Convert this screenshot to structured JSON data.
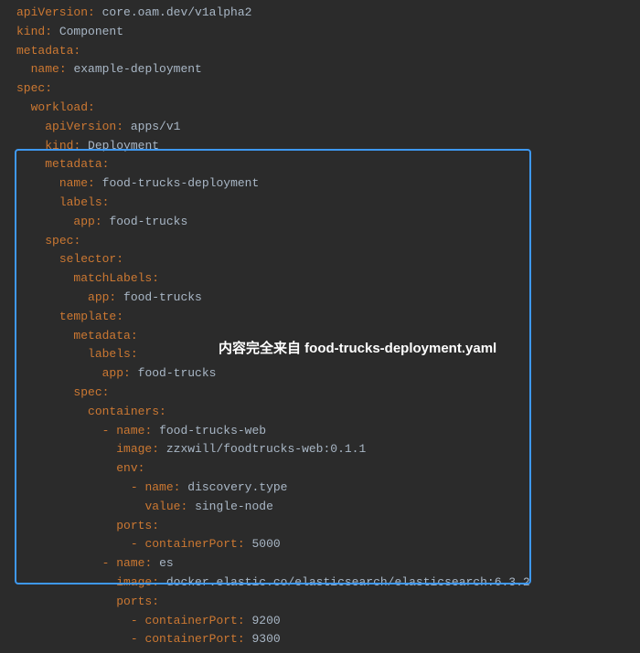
{
  "annotation": "内容完全来自 food-trucks-deployment.yaml",
  "lines": [
    {
      "indent": 0,
      "tokens": [
        {
          "t": "key",
          "v": "apiVersion"
        },
        {
          "t": "col",
          "v": ": "
        },
        {
          "t": "val",
          "v": "core.oam.dev/v1alpha2"
        }
      ]
    },
    {
      "indent": 0,
      "tokens": [
        {
          "t": "key",
          "v": "kind"
        },
        {
          "t": "col",
          "v": ": "
        },
        {
          "t": "val",
          "v": "Component"
        }
      ]
    },
    {
      "indent": 0,
      "tokens": [
        {
          "t": "key",
          "v": "metadata"
        },
        {
          "t": "col",
          "v": ":"
        }
      ]
    },
    {
      "indent": 1,
      "tokens": [
        {
          "t": "key",
          "v": "name"
        },
        {
          "t": "col",
          "v": ": "
        },
        {
          "t": "val",
          "v": "example-deployment"
        }
      ]
    },
    {
      "indent": 0,
      "tokens": [
        {
          "t": "key",
          "v": "spec"
        },
        {
          "t": "col",
          "v": ":"
        }
      ]
    },
    {
      "indent": 1,
      "tokens": [
        {
          "t": "key",
          "v": "workload"
        },
        {
          "t": "col",
          "v": ":"
        }
      ]
    },
    {
      "indent": 2,
      "tokens": [
        {
          "t": "key",
          "v": "apiVersion"
        },
        {
          "t": "col",
          "v": ": "
        },
        {
          "t": "val",
          "v": "apps/v1"
        }
      ]
    },
    {
      "indent": 2,
      "tokens": [
        {
          "t": "key",
          "v": "kind"
        },
        {
          "t": "col",
          "v": ": "
        },
        {
          "t": "val",
          "v": "Deployment"
        }
      ]
    },
    {
      "indent": 2,
      "tokens": [
        {
          "t": "key",
          "v": "metadata"
        },
        {
          "t": "col",
          "v": ":"
        }
      ]
    },
    {
      "indent": 3,
      "tokens": [
        {
          "t": "key",
          "v": "name"
        },
        {
          "t": "col",
          "v": ": "
        },
        {
          "t": "val",
          "v": "food-trucks-deployment"
        }
      ]
    },
    {
      "indent": 3,
      "tokens": [
        {
          "t": "key",
          "v": "labels"
        },
        {
          "t": "col",
          "v": ":"
        }
      ]
    },
    {
      "indent": 4,
      "tokens": [
        {
          "t": "key",
          "v": "app"
        },
        {
          "t": "col",
          "v": ": "
        },
        {
          "t": "val",
          "v": "food-trucks"
        }
      ]
    },
    {
      "indent": 2,
      "tokens": [
        {
          "t": "key",
          "v": "spec"
        },
        {
          "t": "col",
          "v": ":"
        }
      ]
    },
    {
      "indent": 3,
      "tokens": [
        {
          "t": "key",
          "v": "selector"
        },
        {
          "t": "col",
          "v": ":"
        }
      ]
    },
    {
      "indent": 4,
      "tokens": [
        {
          "t": "key",
          "v": "matchLabels"
        },
        {
          "t": "col",
          "v": ":"
        }
      ]
    },
    {
      "indent": 5,
      "tokens": [
        {
          "t": "key",
          "v": "app"
        },
        {
          "t": "col",
          "v": ": "
        },
        {
          "t": "val",
          "v": "food-trucks"
        }
      ]
    },
    {
      "indent": 3,
      "tokens": [
        {
          "t": "key",
          "v": "template"
        },
        {
          "t": "col",
          "v": ":"
        }
      ]
    },
    {
      "indent": 4,
      "tokens": [
        {
          "t": "key",
          "v": "metadata"
        },
        {
          "t": "col",
          "v": ":"
        }
      ]
    },
    {
      "indent": 5,
      "tokens": [
        {
          "t": "key",
          "v": "labels"
        },
        {
          "t": "col",
          "v": ":"
        }
      ]
    },
    {
      "indent": 6,
      "tokens": [
        {
          "t": "key",
          "v": "app"
        },
        {
          "t": "col",
          "v": ": "
        },
        {
          "t": "val",
          "v": "food-trucks"
        }
      ]
    },
    {
      "indent": 4,
      "tokens": [
        {
          "t": "key",
          "v": "spec"
        },
        {
          "t": "col",
          "v": ":"
        }
      ]
    },
    {
      "indent": 5,
      "tokens": [
        {
          "t": "key",
          "v": "containers"
        },
        {
          "t": "col",
          "v": ":"
        }
      ]
    },
    {
      "indent": 6,
      "tokens": [
        {
          "t": "dash",
          "v": "- "
        },
        {
          "t": "key",
          "v": "name"
        },
        {
          "t": "col",
          "v": ": "
        },
        {
          "t": "val",
          "v": "food-trucks-web"
        }
      ]
    },
    {
      "indent": 7,
      "tokens": [
        {
          "t": "key",
          "v": "image"
        },
        {
          "t": "col",
          "v": ": "
        },
        {
          "t": "val",
          "v": "zzxwill/foodtrucks-web:0.1.1"
        }
      ]
    },
    {
      "indent": 7,
      "tokens": [
        {
          "t": "key",
          "v": "env"
        },
        {
          "t": "col",
          "v": ":"
        }
      ]
    },
    {
      "indent": 8,
      "tokens": [
        {
          "t": "dash",
          "v": "- "
        },
        {
          "t": "key",
          "v": "name"
        },
        {
          "t": "col",
          "v": ": "
        },
        {
          "t": "val",
          "v": "discovery.type"
        }
      ]
    },
    {
      "indent": 9,
      "tokens": [
        {
          "t": "key",
          "v": "value"
        },
        {
          "t": "col",
          "v": ": "
        },
        {
          "t": "val",
          "v": "single-node"
        }
      ]
    },
    {
      "indent": 7,
      "tokens": [
        {
          "t": "key",
          "v": "ports"
        },
        {
          "t": "col",
          "v": ":"
        }
      ]
    },
    {
      "indent": 8,
      "tokens": [
        {
          "t": "dash",
          "v": "- "
        },
        {
          "t": "key",
          "v": "containerPort"
        },
        {
          "t": "col",
          "v": ": "
        },
        {
          "t": "val",
          "v": "5000"
        }
      ]
    },
    {
      "indent": 6,
      "tokens": [
        {
          "t": "dash",
          "v": "- "
        },
        {
          "t": "key",
          "v": "name"
        },
        {
          "t": "col",
          "v": ": "
        },
        {
          "t": "val",
          "v": "es"
        }
      ]
    },
    {
      "indent": 7,
      "tokens": [
        {
          "t": "key",
          "v": "image"
        },
        {
          "t": "col",
          "v": ": "
        },
        {
          "t": "val",
          "v": "docker.elastic.co/elasticsearch/elasticsearch:6.3.2"
        }
      ]
    },
    {
      "indent": 7,
      "tokens": [
        {
          "t": "key",
          "v": "ports"
        },
        {
          "t": "col",
          "v": ":"
        }
      ]
    },
    {
      "indent": 8,
      "tokens": [
        {
          "t": "dash",
          "v": "- "
        },
        {
          "t": "key",
          "v": "containerPort"
        },
        {
          "t": "col",
          "v": ": "
        },
        {
          "t": "val",
          "v": "9200"
        }
      ]
    },
    {
      "indent": 8,
      "tokens": [
        {
          "t": "dash",
          "v": "- "
        },
        {
          "t": "key",
          "v": "containerPort"
        },
        {
          "t": "col",
          "v": ": "
        },
        {
          "t": "val",
          "v": "9300"
        }
      ]
    }
  ]
}
